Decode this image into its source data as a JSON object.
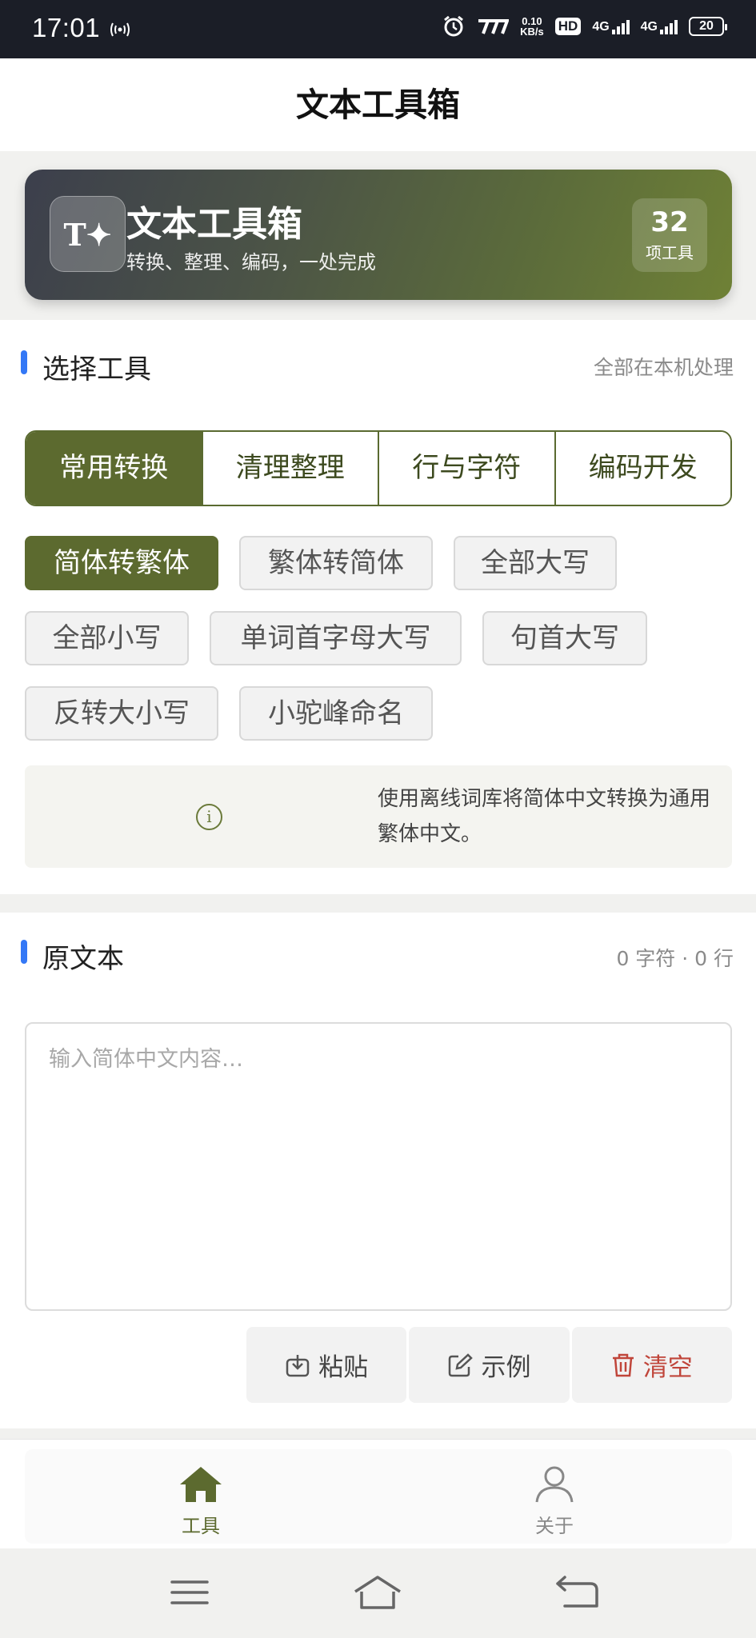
{
  "status": {
    "time": "17:01",
    "net_speed_top": "0.10",
    "net_speed_bottom": "KB/s",
    "hd_label": "HD",
    "sim1": "4G",
    "sim2": "4G",
    "battery": "20"
  },
  "header": {
    "title": "文本工具箱"
  },
  "hero": {
    "icon_text": "T✦",
    "title": "文本工具箱",
    "subtitle": "转换、整理、编码，一处完成",
    "count": "32",
    "count_label": "项工具"
  },
  "tools_section": {
    "title": "选择工具",
    "note": "全部在本机处理",
    "tabs": [
      "常用转换",
      "清理整理",
      "行与字符",
      "编码开发"
    ],
    "active_tab": 0,
    "chips": [
      "简体转繁体",
      "繁体转简体",
      "全部大写",
      "全部小写",
      "单词首字母大写",
      "句首大写",
      "反转大小写",
      "小驼峰命名"
    ],
    "active_chip": 0,
    "info_icon": "info-icon",
    "info_text": "使用离线词库将简体中文转换为通用繁体中文。"
  },
  "source_section": {
    "title": "原文本",
    "stats": "0 字符 · 0 行",
    "placeholder": "输入简体中文内容…",
    "value": "",
    "actions": {
      "paste": "粘贴",
      "example": "示例",
      "clear": "清空"
    },
    "clear_color": "#c0453a"
  },
  "tabbar": {
    "items": [
      {
        "label": "工具",
        "icon": "home-icon",
        "active": true
      },
      {
        "label": "关于",
        "icon": "user-icon",
        "active": false
      }
    ]
  },
  "colors": {
    "accent": "#5c6a2f",
    "section_marker": "#3478f6"
  }
}
